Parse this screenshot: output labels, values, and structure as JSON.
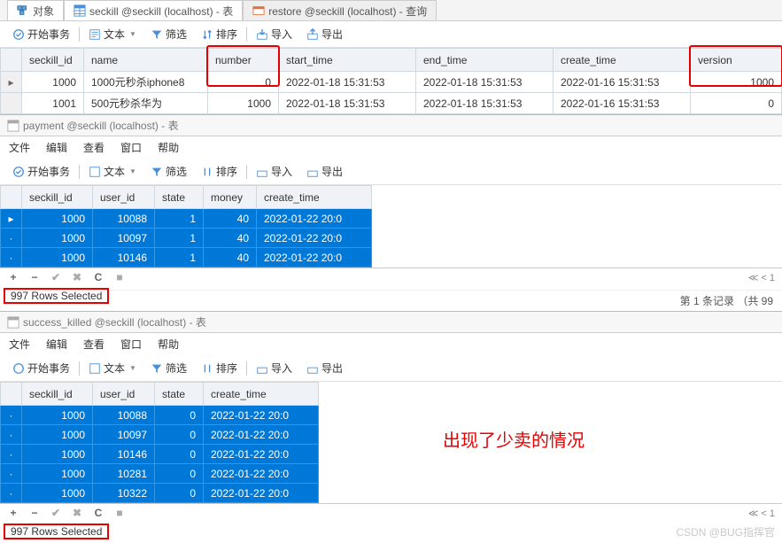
{
  "tabs": {
    "t0": "对象",
    "t1": "seckill @seckill (localhost) - 表",
    "t2": "restore @seckill (localhost) - 查询"
  },
  "toolbar": {
    "beginTx": "开始事务",
    "text": "文本",
    "filter": "筛选",
    "sort": "排序",
    "import": "导入",
    "export": "导出"
  },
  "table1": {
    "headers": {
      "seckill_id": "seckill_id",
      "name": "name",
      "number": "number",
      "start_time": "start_time",
      "end_time": "end_time",
      "create_time": "create_time",
      "version": "version"
    },
    "rows": [
      {
        "seckill_id": "1000",
        "name": "1000元秒杀iphone8",
        "number": "0",
        "start_time": "2022-01-18 15:31:53",
        "end_time": "2022-01-18 15:31:53",
        "create_time": "2022-01-16 15:31:53",
        "version": "1000"
      },
      {
        "seckill_id": "1001",
        "name": "500元秒杀华为",
        "number": "1000",
        "start_time": "2022-01-18 15:31:53",
        "end_time": "2022-01-18 15:31:53",
        "create_time": "2022-01-16 15:31:53",
        "version": "0"
      }
    ]
  },
  "panel2": {
    "title": "payment @seckill (localhost) - 表"
  },
  "menu": {
    "file": "文件",
    "edit": "编辑",
    "view": "查看",
    "window": "窗口",
    "help": "帮助"
  },
  "table2": {
    "headers": {
      "seckill_id": "seckill_id",
      "user_id": "user_id",
      "state": "state",
      "money": "money",
      "create_time": "create_time"
    },
    "rows": [
      {
        "seckill_id": "1000",
        "user_id": "10088",
        "state": "1",
        "money": "40",
        "create_time": "2022-01-22 20:0"
      },
      {
        "seckill_id": "1000",
        "user_id": "10097",
        "state": "1",
        "money": "40",
        "create_time": "2022-01-22 20:0"
      },
      {
        "seckill_id": "1000",
        "user_id": "10146",
        "state": "1",
        "money": "40",
        "create_time": "2022-01-22 20:0"
      }
    ]
  },
  "footer": {
    "rowsSelected": "997 Rows Selected",
    "pageInfo": "第 1 条记录 （共 99"
  },
  "panel3": {
    "title": "success_killed @seckill (localhost) - 表"
  },
  "table3": {
    "headers": {
      "seckill_id": "seckill_id",
      "user_id": "user_id",
      "state": "state",
      "create_time": "create_time"
    },
    "rows": [
      {
        "seckill_id": "1000",
        "user_id": "10088",
        "state": "0",
        "create_time": "2022-01-22 20:0"
      },
      {
        "seckill_id": "1000",
        "user_id": "10097",
        "state": "0",
        "create_time": "2022-01-22 20:0"
      },
      {
        "seckill_id": "1000",
        "user_id": "10146",
        "state": "0",
        "create_time": "2022-01-22 20:0"
      },
      {
        "seckill_id": "1000",
        "user_id": "10281",
        "state": "0",
        "create_time": "2022-01-22 20:0"
      },
      {
        "seckill_id": "1000",
        "user_id": "10322",
        "state": "0",
        "create_time": "2022-01-22 20:0"
      }
    ]
  },
  "annotation": {
    "bigRed": "出现了少卖的情况"
  },
  "watermark": "CSDN @BUG指挥官"
}
